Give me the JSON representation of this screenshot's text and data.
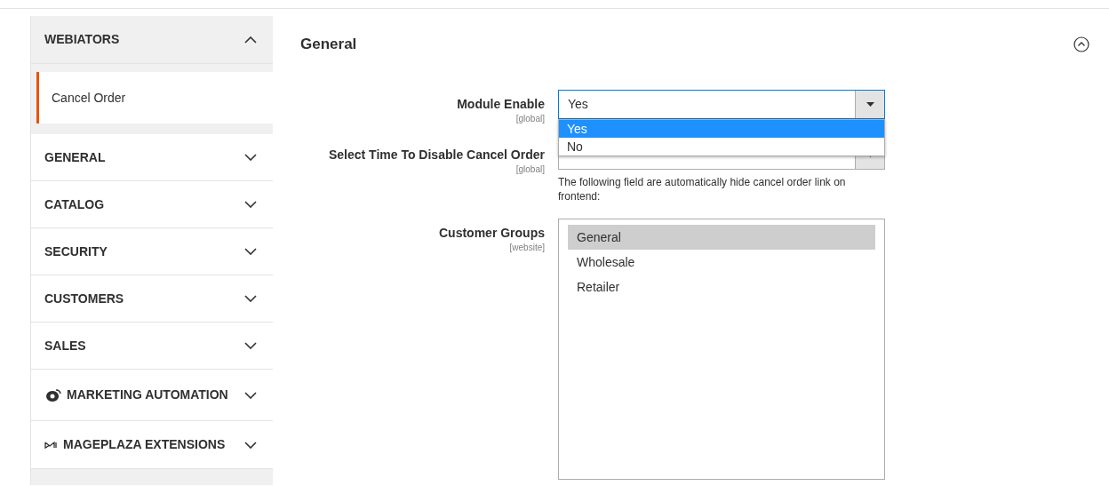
{
  "sidebar": {
    "sections": [
      {
        "title": "WEBIATORS",
        "kind": "plain",
        "expanded": true,
        "items": [
          {
            "label": "Cancel Order",
            "selected": true
          }
        ]
      },
      {
        "title": "GENERAL",
        "kind": "plain",
        "expanded": false
      },
      {
        "title": "CATALOG",
        "kind": "plain",
        "expanded": false
      },
      {
        "title": "SECURITY",
        "kind": "plain",
        "expanded": false
      },
      {
        "title": "CUSTOMERS",
        "kind": "plain",
        "expanded": false
      },
      {
        "title": "SALES",
        "kind": "plain",
        "expanded": false
      },
      {
        "title": "MARKETING AUTOMATION",
        "kind": "marketing",
        "expanded": false
      },
      {
        "title": "MAGEPLAZA EXTENSIONS",
        "kind": "mageplaza",
        "expanded": false
      }
    ]
  },
  "main": {
    "title": "General",
    "fields": [
      {
        "kind": "select",
        "label": "Module Enable",
        "scope": "[global]",
        "value": "Yes",
        "open": true,
        "options": [
          {
            "label": "Yes",
            "selected": true
          },
          {
            "label": "No",
            "selected": false
          }
        ]
      },
      {
        "kind": "select",
        "label": "Select Time To Disable Cancel Order",
        "scope": "[global]",
        "open": false,
        "note": "The following field are automatically hide cancel order link on frontend:"
      },
      {
        "kind": "multiselect",
        "label": "Customer Groups",
        "scope": "[website]",
        "options": [
          {
            "label": "General",
            "selected": true
          },
          {
            "label": "Wholesale",
            "selected": false
          },
          {
            "label": "Retailer",
            "selected": false
          }
        ]
      }
    ]
  }
}
